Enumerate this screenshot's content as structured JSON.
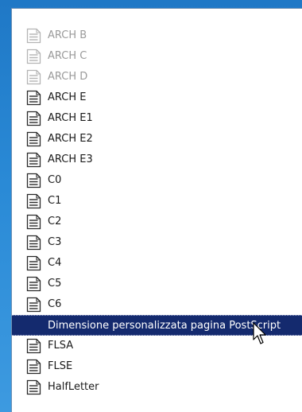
{
  "paper_list": {
    "items": [
      {
        "label": "ARCH B",
        "state": "faded",
        "icon": "document-icon"
      },
      {
        "label": "ARCH C",
        "state": "faded",
        "icon": "document-icon"
      },
      {
        "label": "ARCH D",
        "state": "faded",
        "icon": "document-icon"
      },
      {
        "label": "ARCH E",
        "state": "normal",
        "icon": "document-icon"
      },
      {
        "label": "ARCH E1",
        "state": "normal",
        "icon": "document-icon"
      },
      {
        "label": "ARCH E2",
        "state": "normal",
        "icon": "document-icon"
      },
      {
        "label": "ARCH E3",
        "state": "normal",
        "icon": "document-icon"
      },
      {
        "label": "C0",
        "state": "normal",
        "icon": "document-icon"
      },
      {
        "label": "C1",
        "state": "normal",
        "icon": "document-icon"
      },
      {
        "label": "C2",
        "state": "normal",
        "icon": "document-icon"
      },
      {
        "label": "C3",
        "state": "normal",
        "icon": "document-icon"
      },
      {
        "label": "C4",
        "state": "normal",
        "icon": "document-icon"
      },
      {
        "label": "C5",
        "state": "normal",
        "icon": "document-icon"
      },
      {
        "label": "C6",
        "state": "normal",
        "icon": "document-icon"
      },
      {
        "label": "Dimensione personalizzata pagina PostScript",
        "state": "selected",
        "icon": ""
      },
      {
        "label": "FLSA",
        "state": "normal",
        "icon": "document-icon"
      },
      {
        "label": "FLSE",
        "state": "normal",
        "icon": "document-icon"
      },
      {
        "label": "HalfLetter",
        "state": "normal",
        "icon": "document-icon"
      }
    ]
  },
  "colors": {
    "selection_background": "#142a6e",
    "desktop_background": "#2a8ad6"
  },
  "cursor": {
    "icon": "mouse-pointer-icon"
  }
}
